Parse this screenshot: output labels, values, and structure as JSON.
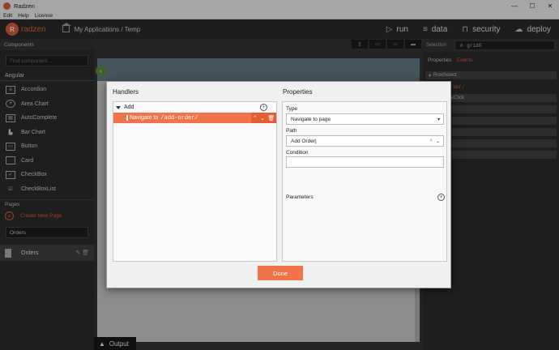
{
  "window": {
    "title": "Radzen",
    "menu": [
      "Edit",
      "Help",
      "License"
    ]
  },
  "appbar": {
    "brand": "radzen",
    "breadcrumb": "My Applications / Temp",
    "nav": [
      {
        "label": "run",
        "icon": "play-icon"
      },
      {
        "label": "data",
        "icon": "database-icon"
      },
      {
        "label": "security",
        "icon": "lock-icon"
      },
      {
        "label": "deploy",
        "icon": "cloud-icon"
      }
    ]
  },
  "sidebar": {
    "header": "Components",
    "search_placeholder": "Find component ...",
    "group": "Angular",
    "components": [
      {
        "label": "Accordion",
        "icon": "accordion-icon"
      },
      {
        "label": "Area Chart",
        "icon": "area-chart-icon"
      },
      {
        "label": "AutoComplete",
        "icon": "autocomplete-icon"
      },
      {
        "label": "Bar Chart",
        "icon": "bar-chart-icon"
      },
      {
        "label": "Button",
        "icon": "button-icon"
      },
      {
        "label": "Card",
        "icon": "card-icon"
      },
      {
        "label": "CheckBox",
        "icon": "checkbox-icon"
      },
      {
        "label": "CheckBoxList",
        "icon": "checkboxlist-icon"
      }
    ],
    "pages_header": "Pages",
    "create_page": "Create New Page",
    "pages_filter": "Orders",
    "pages": [
      {
        "label": "Orders"
      }
    ]
  },
  "right_panel": {
    "selection_label": "Selection",
    "selection_value": "grid0",
    "tabs": [
      "Properties",
      "Events"
    ],
    "rows": [
      "RowSelect",
      "RowDoubleClick"
    ],
    "path_fragment": "/add-order/"
  },
  "output_tab": "Output",
  "dialog": {
    "handlers_title": "Handlers",
    "properties_title": "Properties",
    "event_name": "Add",
    "handler_label": "Navigate to",
    "handler_path": "/add-order/",
    "type_label": "Type",
    "type_value": "Navigate to page",
    "path_label": "Path",
    "path_value": "Add Order",
    "condition_label": "Condition",
    "condition_value": "",
    "parameters_label": "Parameters",
    "done_label": "Done"
  }
}
